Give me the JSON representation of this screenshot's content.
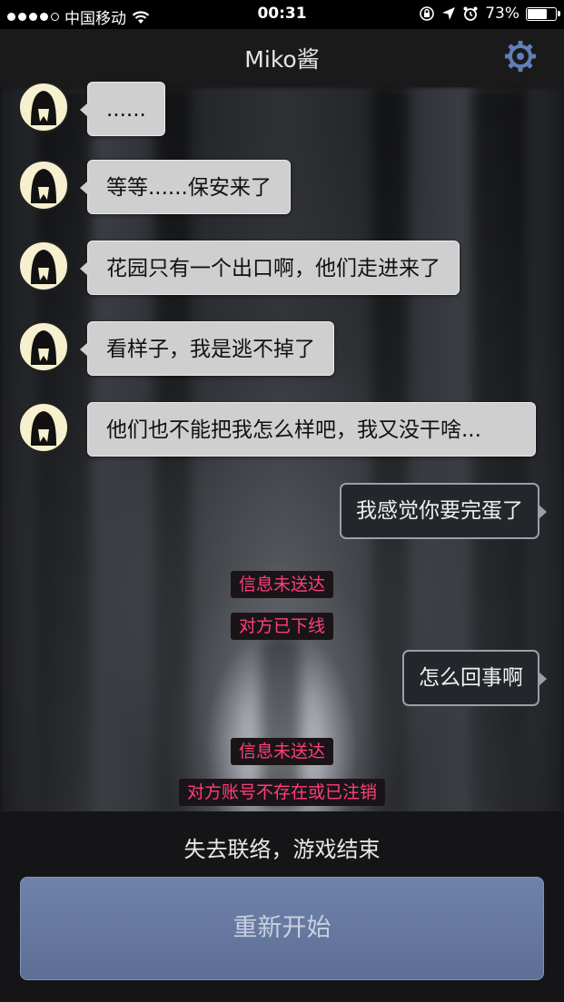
{
  "status_bar": {
    "carrier": "中国移动",
    "time": "00:31",
    "battery": "73%",
    "battery_level": 0.73
  },
  "nav": {
    "title": "Miko酱",
    "settings_icon": "gear-icon",
    "accent_color": "#5f7fb8"
  },
  "messages": [
    {
      "side": "in",
      "text": "......"
    },
    {
      "side": "in",
      "text": "等等......保安来了"
    },
    {
      "side": "in",
      "text": "花园只有一个出口啊，他们走进来了"
    },
    {
      "side": "in",
      "text": "看样子，我是逃不掉了"
    },
    {
      "side": "in",
      "text": "他们也不能把我怎么样吧，我又没干啥..."
    },
    {
      "side": "out",
      "text": "我感觉你要完蛋了"
    },
    {
      "side": "system",
      "text": "信息未送达"
    },
    {
      "side": "system",
      "text": "对方已下线"
    },
    {
      "side": "out",
      "text": "怎么回事啊"
    },
    {
      "side": "system",
      "text": "信息未送达"
    },
    {
      "side": "system",
      "text": "对方账号不存在或已注销"
    }
  ],
  "footer": {
    "game_over_text": "失去联络，游戏结束",
    "restart_label": "重新开始"
  },
  "colors": {
    "system_text": "#ff3f77",
    "incoming_bubble": "#cfcfcf",
    "outgoing_bubble": "#23262b",
    "restart_button": "#6477a0"
  }
}
